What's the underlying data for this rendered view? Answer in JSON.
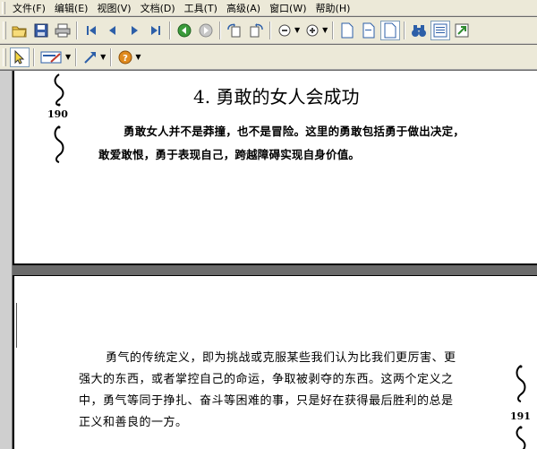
{
  "menu": [
    "文件(F)",
    "编辑(E)",
    "视图(V)",
    "文档(D)",
    "工具(T)",
    "高级(A)",
    "窗口(W)",
    "帮助(H)"
  ],
  "toolbar1": {
    "icons": [
      "open-folder-icon",
      "save-disk-icon",
      "print-icon",
      "first-page-icon",
      "previous-page-icon",
      "next-page-icon",
      "last-page-icon",
      "go-back-icon",
      "go-forward-icon",
      "rotate-clockwise-icon",
      "rotate-counterclockwise-icon",
      "zoom-out-icon",
      "zoom-in-icon",
      "single-page-icon",
      "continuous-page-icon",
      "fit-page-icon",
      "find-binoculars-icon",
      "list-view-icon",
      "export-icon"
    ]
  },
  "toolbar2": {
    "icons": [
      "select-arrow-icon",
      "annotation-tool-icon",
      "link-arrow-icon",
      "help-icon"
    ]
  },
  "page190": {
    "number": "190",
    "title": "4.  勇敢的女人会成功",
    "lines": [
      "勇敢女人并不是莽撞，也不是冒险。这里的勇敢包括勇于做出决定，",
      "敢爱敢恨，勇于表现自己，跨越障碍实现自身价值。"
    ]
  },
  "page191": {
    "number": "191",
    "lines": [
      "勇气的传统定义，即为挑战或克服某些我们认为比我们更厉害、更",
      "强大的东西，或者掌控自己的命运，争取被剥夺的东西。这两个定义之",
      "中，勇气等同于挣扎、奋斗等困难的事，只是好在获得最后胜利的总是",
      "正义和善良的一方。"
    ]
  },
  "colors": {
    "chrome": "#ece9d8",
    "workspace": "#6b6b6b",
    "page": "#ffffff"
  }
}
